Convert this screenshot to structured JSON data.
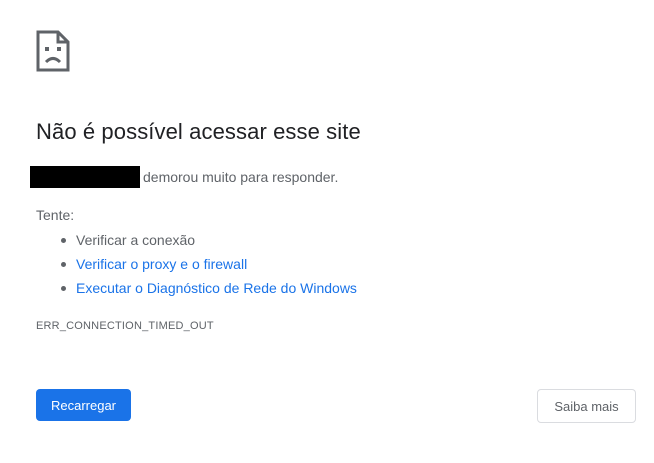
{
  "error": {
    "icon": "sad-page-icon",
    "title": "Não é possível acessar esse site",
    "summary_suffix": "demorou muito para responder.",
    "try_label": "Tente:",
    "suggestions": [
      {
        "text": "Verificar a conexão",
        "link": false
      },
      {
        "text": "Verificar o proxy e o firewall",
        "link": true
      },
      {
        "text": "Executar o Diagnóstico de Rede do Windows",
        "link": true
      }
    ],
    "code": "ERR_CONNECTION_TIMED_OUT"
  },
  "buttons": {
    "reload_label": "Recarregar",
    "details_label": "Saiba mais"
  },
  "colors": {
    "accent": "#1a73e8",
    "text_primary": "#202124",
    "text_secondary": "#5f6368",
    "button_border": "#dadce0",
    "redaction": "#000000"
  }
}
